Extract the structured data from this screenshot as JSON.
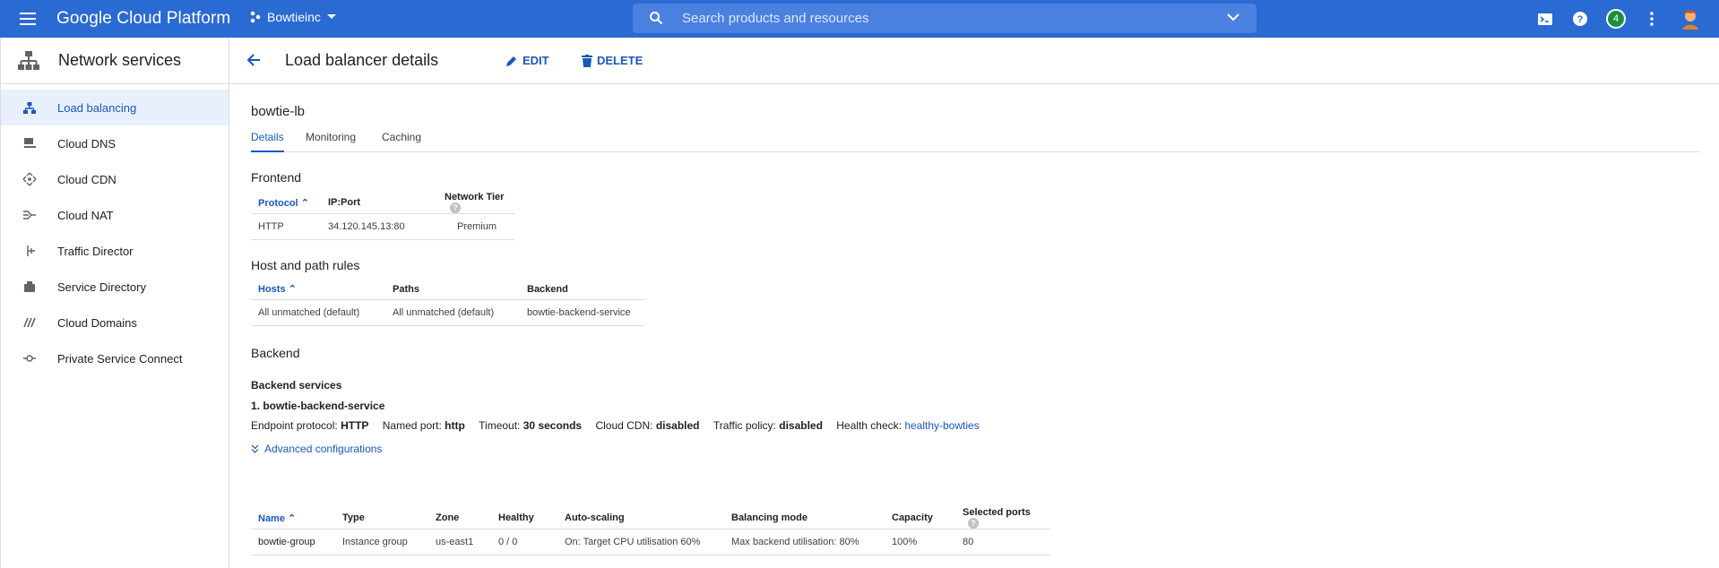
{
  "topbar": {
    "brand": "Google Cloud Platform",
    "project": "Bowtieinc",
    "search_placeholder": "Search products and resources",
    "notifications_count": "4"
  },
  "sidebar": {
    "title": "Network services",
    "items": [
      {
        "label": "Load balancing",
        "icon": "load-balancing-icon"
      },
      {
        "label": "Cloud DNS",
        "icon": "dns-icon"
      },
      {
        "label": "Cloud CDN",
        "icon": "cdn-icon"
      },
      {
        "label": "Cloud NAT",
        "icon": "nat-icon"
      },
      {
        "label": "Traffic Director",
        "icon": "traffic-director-icon"
      },
      {
        "label": "Service Directory",
        "icon": "service-directory-icon"
      },
      {
        "label": "Cloud Domains",
        "icon": "domains-icon"
      },
      {
        "label": "Private Service Connect",
        "icon": "private-service-connect-icon"
      }
    ]
  },
  "header": {
    "title": "Load balancer details",
    "edit": "EDIT",
    "delete": "DELETE"
  },
  "lb": {
    "name": "bowtie-lb"
  },
  "tabs": [
    "Details",
    "Monitoring",
    "Caching"
  ],
  "frontend": {
    "title": "Frontend",
    "headers": [
      "Protocol",
      "IP:Port",
      "Network Tier"
    ],
    "row": [
      "HTTP",
      "34.120.145.13:80",
      "Premium"
    ]
  },
  "hostpath": {
    "title": "Host and path rules",
    "headers": [
      "Hosts",
      "Paths",
      "Backend"
    ],
    "row": [
      "All unmatched (default)",
      "All unmatched (default)",
      "bowtie-backend-service"
    ]
  },
  "backend": {
    "title": "Backend",
    "subtitle": "Backend services",
    "service_name": "1. bowtie-backend-service",
    "endpoint_label": "Endpoint protocol:",
    "endpoint_value": "HTTP",
    "port_label": "Named port:",
    "port_value": "http",
    "timeout_label": "Timeout:",
    "timeout_value": "30 seconds",
    "cdn_label": "Cloud CDN:",
    "cdn_value": "disabled",
    "traffic_label": "Traffic policy:",
    "traffic_value": "disabled",
    "health_label": "Health check:",
    "health_value": "healthy-bowties",
    "advanced": "Advanced configurations",
    "headers": [
      "Name",
      "Type",
      "Zone",
      "Healthy",
      "Auto-scaling",
      "Balancing mode",
      "Capacity",
      "Selected ports"
    ],
    "row": [
      "bowtie-group",
      "Instance group",
      "us-east1",
      "0 / 0",
      "On: Target CPU utilisation 60%",
      "Max backend utilisation: 80%",
      "100%",
      "80"
    ]
  },
  "colors": {
    "topbar": "#2a6ad3",
    "accent": "#1a57b8"
  }
}
